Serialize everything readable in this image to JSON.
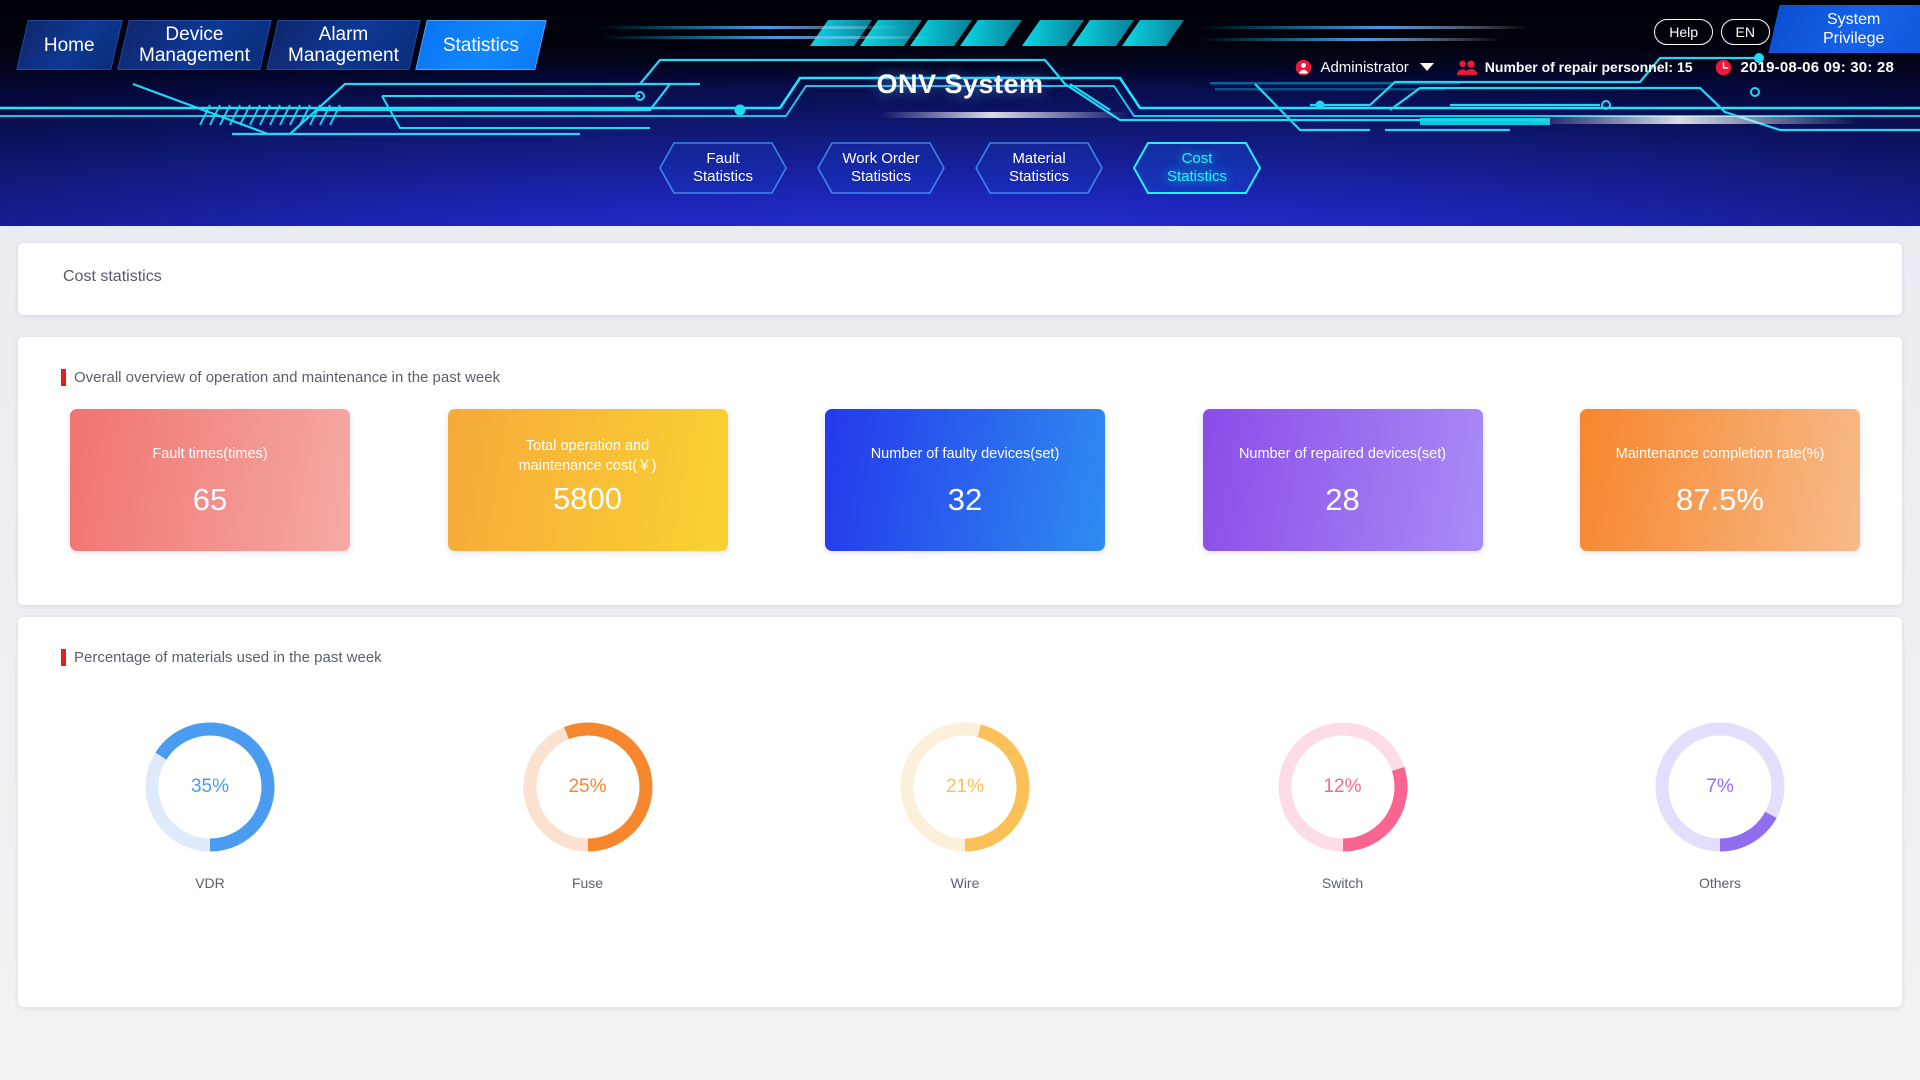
{
  "header": {
    "brand": "ONV System",
    "nav": [
      {
        "label": "Home",
        "active": false
      },
      {
        "label": "Device\nManagement",
        "active": false
      },
      {
        "label": "Alarm\nManagement",
        "active": false
      },
      {
        "label": "Statistics",
        "active": true
      }
    ],
    "help_label": "Help",
    "lang_label": "EN",
    "system_privilege_label": "System\nPrivilege",
    "user_icon": "user-circle-icon",
    "user_name": "Administrator",
    "caret_icon": "chevron-down-icon",
    "personnel_icon": "people-icon",
    "personnel_label": "Number of repair personnel: 15",
    "clock_icon": "clock-icon",
    "datetime": "2019-08-06 09: 30: 28",
    "subtabs": [
      {
        "label": "Fault\nStatistics",
        "active": false
      },
      {
        "label": "Work Order\nStatistics",
        "active": false
      },
      {
        "label": "Material\nStatistics",
        "active": false
      },
      {
        "label": "Cost\nStatistics",
        "active": true
      }
    ]
  },
  "page": {
    "title": "Cost statistics",
    "overview_section_title": "Overall overview of operation and maintenance in the past week",
    "materials_section_title": "Percentage of materials used in the past week",
    "accent_bar_color": "#e02020"
  },
  "chart_data": [
    {
      "type": "table",
      "title": "Overall overview of operation and maintenance in the past week",
      "categories": [
        "Fault times(times)",
        "Total operation and\nmaintenance cost(￥)",
        "Number of faulty devices(set)",
        "Number of repaired devices(set)",
        "Maintenance completion rate(%)"
      ],
      "values": [
        "65",
        "5800",
        "32",
        "28",
        "87.5%"
      ],
      "cards": [
        {
          "label": "Fault times(times)",
          "value": "65",
          "from": "#f0736f",
          "to": "#f6aaa5",
          "one_line": true
        },
        {
          "label": "Total operation and\nmaintenance cost(￥)",
          "value": "5800",
          "from": "#f7a93a",
          "to": "#f9d331",
          "one_line": false
        },
        {
          "label": "Number of faulty devices(set)",
          "value": "32",
          "from": "#2438ec",
          "to": "#2f8cf0",
          "one_line": true
        },
        {
          "label": "Number of repaired devices(set)",
          "value": "28",
          "from": "#8a4ce8",
          "to": "#a98cf6",
          "one_line": true
        },
        {
          "label": "Maintenance completion rate(%)",
          "value": "87.5%",
          "from": "#f7862c",
          "to": "#f7bb8a",
          "one_line": true
        }
      ]
    },
    {
      "type": "pie",
      "title": "Percentage of materials used in the past week",
      "categories": [
        "VDR",
        "Fuse",
        "Wire",
        "Switch",
        "Others"
      ],
      "values": [
        35,
        25,
        21,
        12,
        7
      ],
      "labels": [
        "35%",
        "25%",
        "21%",
        "12%",
        "7%"
      ],
      "ylabel": "",
      "xlabel": "",
      "legend": "none",
      "segments": [
        {
          "label": "VDR",
          "value": 35,
          "display": "35%",
          "color": "#4a9cf0",
          "track": "#dfeafb",
          "arc_fraction": 0.66
        },
        {
          "label": "Fuse",
          "value": 25,
          "display": "25%",
          "color": "#f7872f",
          "track": "#fbe1cf",
          "arc_fraction": 0.56
        },
        {
          "label": "Wire",
          "value": 21,
          "display": "21%",
          "color": "#fbc158",
          "track": "#fdf0da",
          "arc_fraction": 0.46
        },
        {
          "label": "Switch",
          "value": 12,
          "display": "12%",
          "color": "#f96590",
          "track": "#fcdde5",
          "arc_fraction": 0.3
        },
        {
          "label": "Others",
          "value": 7,
          "display": "7%",
          "color": "#8f6ff0",
          "track": "#e4ddfb",
          "arc_fraction": 0.17
        }
      ]
    }
  ]
}
